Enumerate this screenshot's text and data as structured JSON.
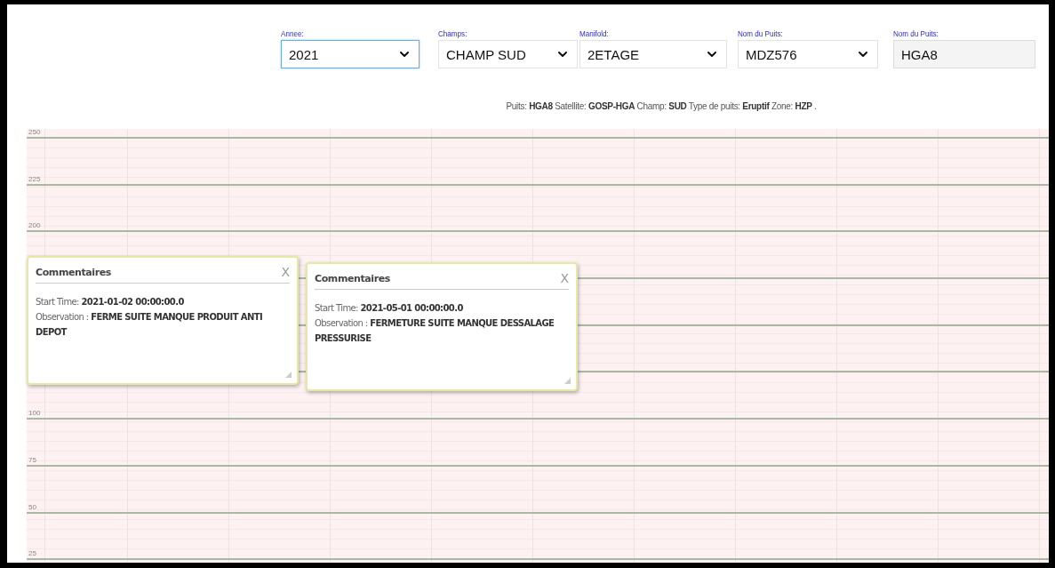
{
  "filters": [
    {
      "kind": "select",
      "label": "Annee:",
      "value": "2021",
      "focused": true
    },
    {
      "kind": "select",
      "label": "Champs:",
      "value": "CHAMP SUD",
      "focused": false
    },
    {
      "kind": "select",
      "label": "Manifold:",
      "value": "2ETAGE",
      "focused": false
    },
    {
      "kind": "select",
      "label": "Nom du Puits:",
      "value": "MDZ576",
      "focused": false
    },
    {
      "kind": "input",
      "label": "Nom du Puits:",
      "value": "HGA8",
      "focused": false
    }
  ],
  "well_info": "Puits: **HGA8** Satellite: **GOSP-HGA** Champ: **SUD** Type de puits: **Eruptif** Zone: **HZP** .",
  "chart": {
    "upper_labels": [
      "250",
      "225",
      "200"
    ],
    "lower_labels": [
      "100",
      "75",
      "50",
      "25"
    ]
  },
  "comments": [
    {
      "title": "Commentaires",
      "close": "X",
      "start_time": "Start Time: **2021-01-02 00:00:00.0**",
      "observation": "Observation : **FERME SUITE MANQUE PRODUIT ANTI DEPOT**"
    },
    {
      "title": "Commentaires",
      "close": "X",
      "start_time": "Start Time: **2021-05-01 00:00:00.0**",
      "observation": "Observation : **FERMETURE SUITE MANQUE DESSALAGE PRESSURISE**"
    }
  ]
}
